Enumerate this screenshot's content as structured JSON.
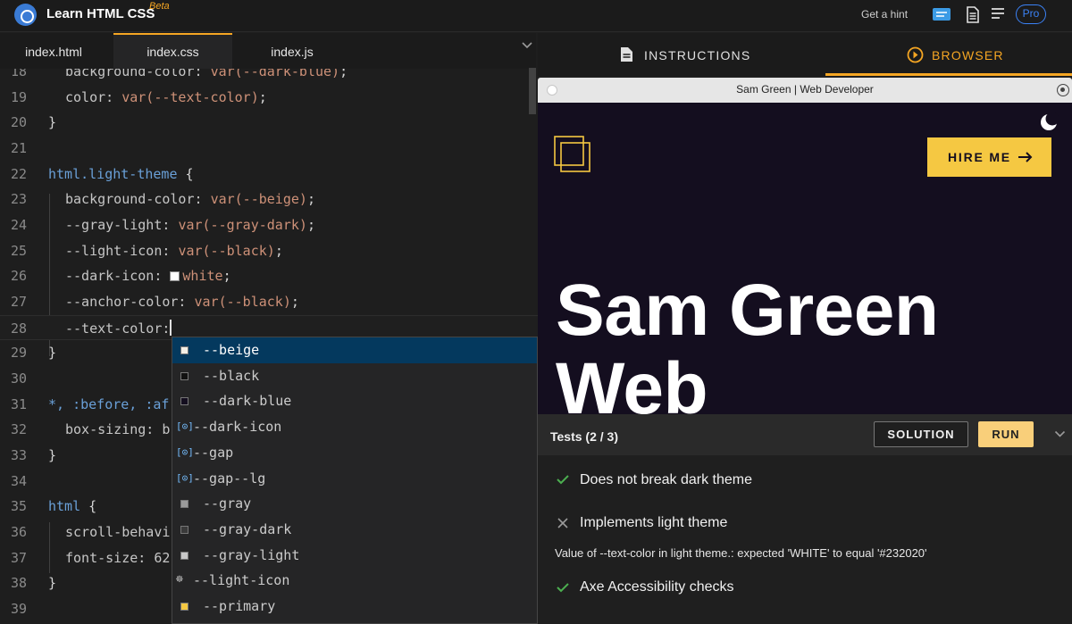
{
  "app": {
    "title": "Learn HTML CSS",
    "badge": "Beta",
    "hint": "Get a hint",
    "pro": "Pro"
  },
  "editor": {
    "tabs": [
      "index.html",
      "index.css",
      "index.js"
    ],
    "active_tab": "index.css",
    "lines": [
      {
        "n": "18",
        "parts": [
          [
            "prop",
            "background-color: "
          ],
          [
            "val",
            "var(--dark-blue)"
          ],
          [
            "plain",
            ";"
          ]
        ],
        "ind": true
      },
      {
        "n": "19",
        "parts": [
          [
            "prop",
            "color: "
          ],
          [
            "val",
            "var(--text-color)"
          ],
          [
            "plain",
            ";"
          ]
        ],
        "ind": true
      },
      {
        "n": "20",
        "parts": [
          [
            "plain",
            "}"
          ]
        ],
        "ind": false
      },
      {
        "n": "21",
        "parts": [],
        "ind": false
      },
      {
        "n": "22",
        "parts": [
          [
            "sel",
            "html.light-theme"
          ],
          [
            "plain",
            " {"
          ]
        ],
        "ind": false
      },
      {
        "n": "23",
        "parts": [
          [
            "prop",
            "background-color: "
          ],
          [
            "val",
            "var(--beige)"
          ],
          [
            "plain",
            ";"
          ]
        ],
        "ind": true
      },
      {
        "n": "24",
        "parts": [
          [
            "prop",
            "--gray-light: "
          ],
          [
            "val",
            "var(--gray-dark)"
          ],
          [
            "plain",
            ";"
          ]
        ],
        "ind": true
      },
      {
        "n": "25",
        "parts": [
          [
            "prop",
            "--light-icon: "
          ],
          [
            "val",
            "var(--black)"
          ],
          [
            "plain",
            ";"
          ]
        ],
        "ind": true
      },
      {
        "n": "26",
        "parts": [
          [
            "prop",
            "--dark-icon: "
          ],
          [
            "swatch",
            ""
          ],
          [
            "val",
            "white"
          ],
          [
            "plain",
            ";"
          ]
        ],
        "ind": true
      },
      {
        "n": "27",
        "parts": [
          [
            "prop",
            "--anchor-color: "
          ],
          [
            "val",
            "var(--black)"
          ],
          [
            "plain",
            ";"
          ]
        ],
        "ind": true
      },
      {
        "n": "28",
        "parts": [
          [
            "prop",
            "--text-color:"
          ],
          [
            "caret",
            ""
          ]
        ],
        "ind": true,
        "current": true
      },
      {
        "n": "29",
        "parts": [
          [
            "plain",
            "}"
          ]
        ],
        "ind": false
      },
      {
        "n": "30",
        "parts": [],
        "ind": false
      },
      {
        "n": "31",
        "parts": [
          [
            "sel",
            "*, :before, :af"
          ]
        ],
        "ind": false
      },
      {
        "n": "32",
        "parts": [
          [
            "prop",
            "box-sizing: b"
          ]
        ],
        "ind": true
      },
      {
        "n": "33",
        "parts": [
          [
            "plain",
            "}"
          ]
        ],
        "ind": false
      },
      {
        "n": "34",
        "parts": [],
        "ind": false
      },
      {
        "n": "35",
        "parts": [
          [
            "sel",
            "html"
          ],
          [
            "plain",
            " {"
          ]
        ],
        "ind": false
      },
      {
        "n": "36",
        "parts": [
          [
            "prop",
            "scroll-behavi"
          ]
        ],
        "ind": true
      },
      {
        "n": "37",
        "parts": [
          [
            "prop",
            "font-size: 62"
          ]
        ],
        "ind": true
      },
      {
        "n": "38",
        "parts": [
          [
            "plain",
            "}"
          ]
        ],
        "ind": false
      },
      {
        "n": "39",
        "parts": [],
        "ind": false
      }
    ],
    "suggestions": [
      {
        "label": "--beige",
        "icon": "color",
        "color": "#f5f0e6",
        "selected": true
      },
      {
        "label": "--black",
        "icon": "color",
        "color": "#111111"
      },
      {
        "label": "--dark-blue",
        "icon": "color",
        "color": "#140e1f"
      },
      {
        "label": "--dark-icon",
        "icon": "variable"
      },
      {
        "label": "--gap",
        "icon": "variable"
      },
      {
        "label": "--gap--lg",
        "icon": "variable"
      },
      {
        "label": "--gray",
        "icon": "color",
        "color": "#9a9a9a"
      },
      {
        "label": "--gray-dark",
        "icon": "color",
        "color": "#3a3a3a"
      },
      {
        "label": "--gray-light",
        "icon": "color",
        "color": "#c8c8c8"
      },
      {
        "label": "--light-icon",
        "icon": "palette"
      },
      {
        "label": "--primary",
        "icon": "color",
        "color": "#f5c842"
      }
    ]
  },
  "panel": {
    "tabs": {
      "instructions": "INSTRUCTIONS",
      "browser": "BROWSER"
    },
    "browser_title": "Sam Green | Web Developer",
    "site": {
      "hire_label": "HIRE ME",
      "hero_line1": "Sam Green",
      "hero_line2": "Web"
    },
    "tests": {
      "title": "Tests (2 / 3)",
      "solution_label": "SOLUTION",
      "run_label": "RUN",
      "items": [
        {
          "label": "Does not break dark theme",
          "status": "pass"
        },
        {
          "label": "Implements light theme",
          "status": "fail"
        },
        {
          "label": "Axe Accessibility checks",
          "status": "pass"
        }
      ],
      "error_message": "Value of --text-color in light theme.: expected 'WHITE' to equal '#232020'"
    }
  },
  "colors": {
    "accent": "#f5a623",
    "hire": "#f5c842",
    "run": "#f9cf7a",
    "pass": "#4caf50",
    "fail": "#9a9a9a",
    "link_blue": "#3b82f6"
  }
}
